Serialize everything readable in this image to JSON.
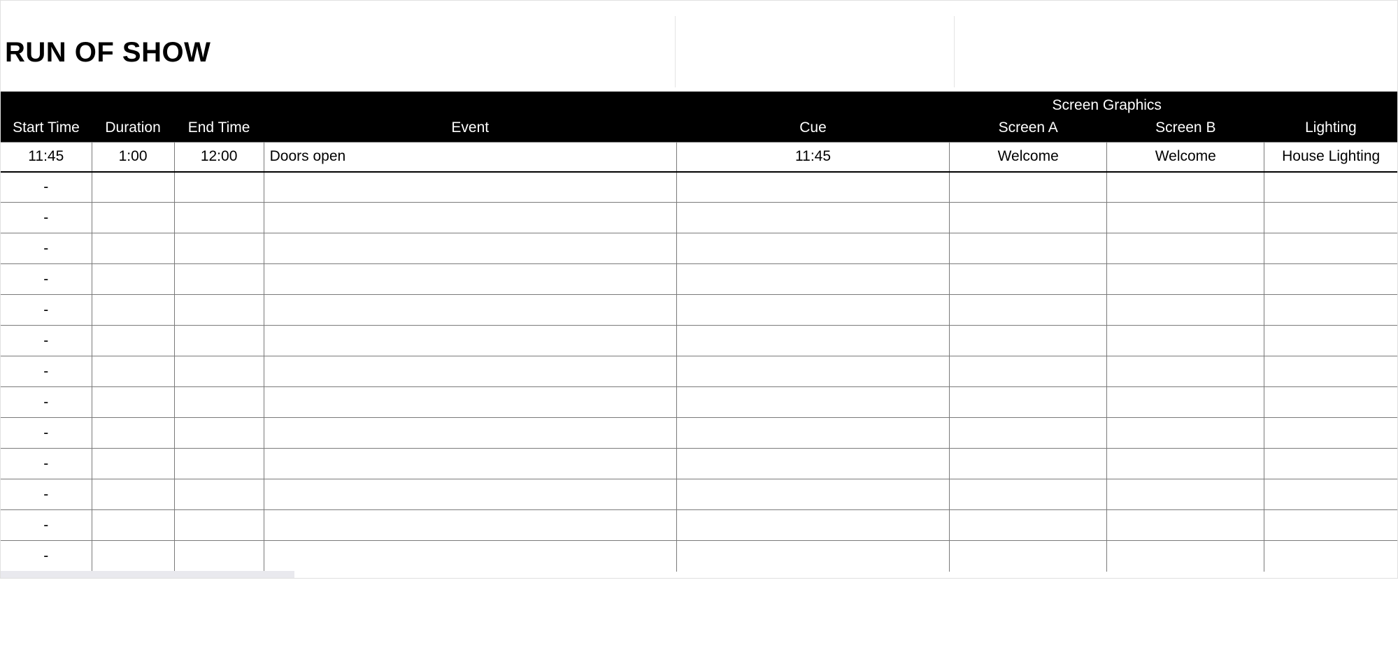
{
  "title": "RUN OF SHOW",
  "header": {
    "group_screen_graphics": "Screen Graphics",
    "start_time": "Start Time",
    "duration": "Duration",
    "end_time": "End Time",
    "event": "Event",
    "cue": "Cue",
    "screen_a": "Screen A",
    "screen_b": "Screen B",
    "lighting": "Lighting"
  },
  "rows": [
    {
      "start": "11:45",
      "duration": "1:00",
      "end": "12:00",
      "event": "Doors open",
      "cue": "11:45",
      "screen_a": "Welcome",
      "screen_b": "Welcome",
      "lighting": "House Lighting"
    },
    {
      "start": "-",
      "duration": "",
      "end": "",
      "event": "",
      "cue": "",
      "screen_a": "",
      "screen_b": "",
      "lighting": ""
    },
    {
      "start": "-",
      "duration": "",
      "end": "",
      "event": "",
      "cue": "",
      "screen_a": "",
      "screen_b": "",
      "lighting": ""
    },
    {
      "start": "-",
      "duration": "",
      "end": "",
      "event": "",
      "cue": "",
      "screen_a": "",
      "screen_b": "",
      "lighting": ""
    },
    {
      "start": "-",
      "duration": "",
      "end": "",
      "event": "",
      "cue": "",
      "screen_a": "",
      "screen_b": "",
      "lighting": ""
    },
    {
      "start": "-",
      "duration": "",
      "end": "",
      "event": "",
      "cue": "",
      "screen_a": "",
      "screen_b": "",
      "lighting": ""
    },
    {
      "start": "-",
      "duration": "",
      "end": "",
      "event": "",
      "cue": "",
      "screen_a": "",
      "screen_b": "",
      "lighting": ""
    },
    {
      "start": "-",
      "duration": "",
      "end": "",
      "event": "",
      "cue": "",
      "screen_a": "",
      "screen_b": "",
      "lighting": ""
    },
    {
      "start": "-",
      "duration": "",
      "end": "",
      "event": "",
      "cue": "",
      "screen_a": "",
      "screen_b": "",
      "lighting": ""
    },
    {
      "start": "-",
      "duration": "",
      "end": "",
      "event": "",
      "cue": "",
      "screen_a": "",
      "screen_b": "",
      "lighting": ""
    },
    {
      "start": "-",
      "duration": "",
      "end": "",
      "event": "",
      "cue": "",
      "screen_a": "",
      "screen_b": "",
      "lighting": ""
    },
    {
      "start": "-",
      "duration": "",
      "end": "",
      "event": "",
      "cue": "",
      "screen_a": "",
      "screen_b": "",
      "lighting": ""
    },
    {
      "start": "-",
      "duration": "",
      "end": "",
      "event": "",
      "cue": "",
      "screen_a": "",
      "screen_b": "",
      "lighting": ""
    },
    {
      "start": "-",
      "duration": "",
      "end": "",
      "event": "",
      "cue": "",
      "screen_a": "",
      "screen_b": "",
      "lighting": ""
    }
  ]
}
